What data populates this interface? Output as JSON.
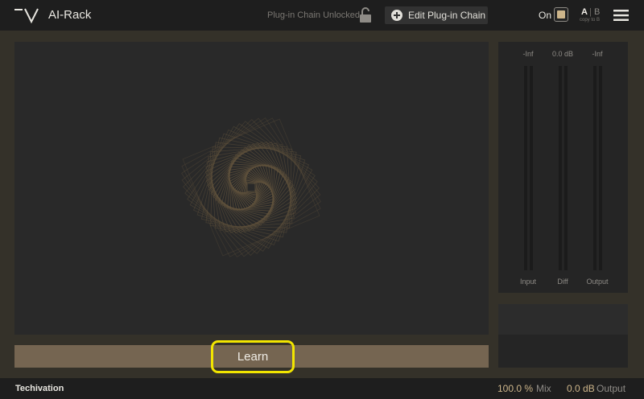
{
  "header": {
    "app_title": "AI-Rack",
    "lock_status": "Plug-in Chain Unlocked",
    "edit_chain_label": "Edit Plug-in Chain",
    "on_label": "On",
    "ab": {
      "a": "A",
      "sep": "|",
      "b": "B",
      "copy": "copy to B"
    }
  },
  "main": {
    "learn_label": "Learn"
  },
  "meters": [
    {
      "value": "-Inf",
      "label": "Input"
    },
    {
      "value": "0.0 dB",
      "label": "Diff"
    },
    {
      "value": "-Inf",
      "label": "Output"
    }
  ],
  "footer": {
    "brand": "Techivation",
    "mix_value": "100.0 %",
    "mix_label": "Mix",
    "output_value": "0.0 dB",
    "output_label": "Output"
  },
  "colors": {
    "accent": "#cdb58a",
    "learn_bar": "#756551",
    "highlight": "#f2e500",
    "background": "#343129"
  }
}
